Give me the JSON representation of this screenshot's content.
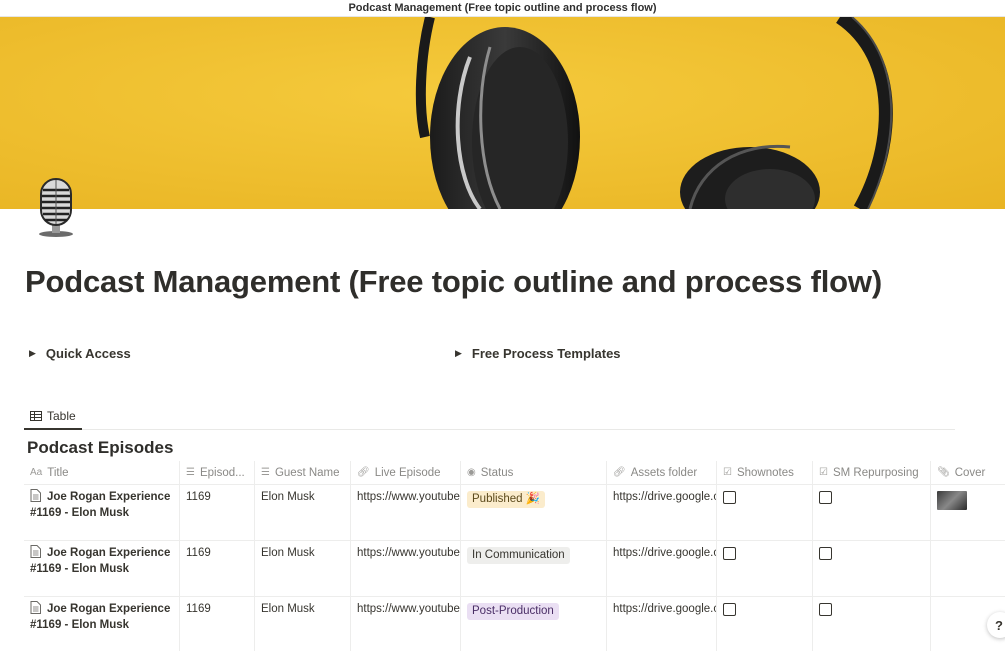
{
  "window": {
    "title": "Podcast Management (Free topic outline and process flow)"
  },
  "page": {
    "title": "Podcast Management (Free topic outline and process flow)",
    "cover_icon": "headphones-cover-image",
    "page_icon": "microphone-icon"
  },
  "toggles": [
    {
      "label": "Quick Access"
    },
    {
      "label": "Free Process Templates"
    }
  ],
  "view": {
    "tab_label": "Table"
  },
  "database": {
    "title": "Podcast Episodes",
    "columns": [
      {
        "label": "Title",
        "icon": "Aa"
      },
      {
        "label": "Episod...",
        "icon": "text-lines-icon"
      },
      {
        "label": "Guest Name",
        "icon": "text-lines-icon"
      },
      {
        "label": "Live Episode",
        "icon": "link-icon"
      },
      {
        "label": "Status",
        "icon": "status-icon"
      },
      {
        "label": "Assets folder",
        "icon": "link-icon"
      },
      {
        "label": "Shownotes",
        "icon": "checkbox-icon"
      },
      {
        "label": "SM Repurposing",
        "icon": "checkbox-icon"
      },
      {
        "label": "Cover",
        "icon": "paperclip-icon"
      }
    ],
    "rows": [
      {
        "title": "Joe Rogan Experience #1169 - Elon Musk",
        "episode": "1169",
        "guest": "Elon Musk",
        "live": "https://www.youtube.com",
        "status": "Published 🎉",
        "status_bg": "#fbeccc",
        "status_color": "#5c4a1c",
        "assets": "https://drive.google.com",
        "shownotes": false,
        "sm": false,
        "has_cover": true
      },
      {
        "title": "Joe Rogan Experience #1169 - Elon Musk",
        "episode": "1169",
        "guest": "Elon Musk",
        "live": "https://www.youtube.com",
        "status": "In Communication",
        "status_bg": "#eeeeec",
        "status_color": "#37352f",
        "assets": "https://drive.google.com",
        "shownotes": false,
        "sm": false,
        "has_cover": false
      },
      {
        "title": "Joe Rogan Experience #1169 - Elon Musk",
        "episode": "1169",
        "guest": "Elon Musk",
        "live": "https://www.youtube.com",
        "status": "Post-Production",
        "status_bg": "#eadff3",
        "status_color": "#4a2e66",
        "assets": "https://drive.google.com",
        "shownotes": false,
        "sm": false,
        "has_cover": false
      }
    ]
  },
  "help": {
    "label": "?"
  },
  "colors": {
    "cover_bg": "#f2c230",
    "text": "#37352f",
    "muted": "#8a8986"
  }
}
